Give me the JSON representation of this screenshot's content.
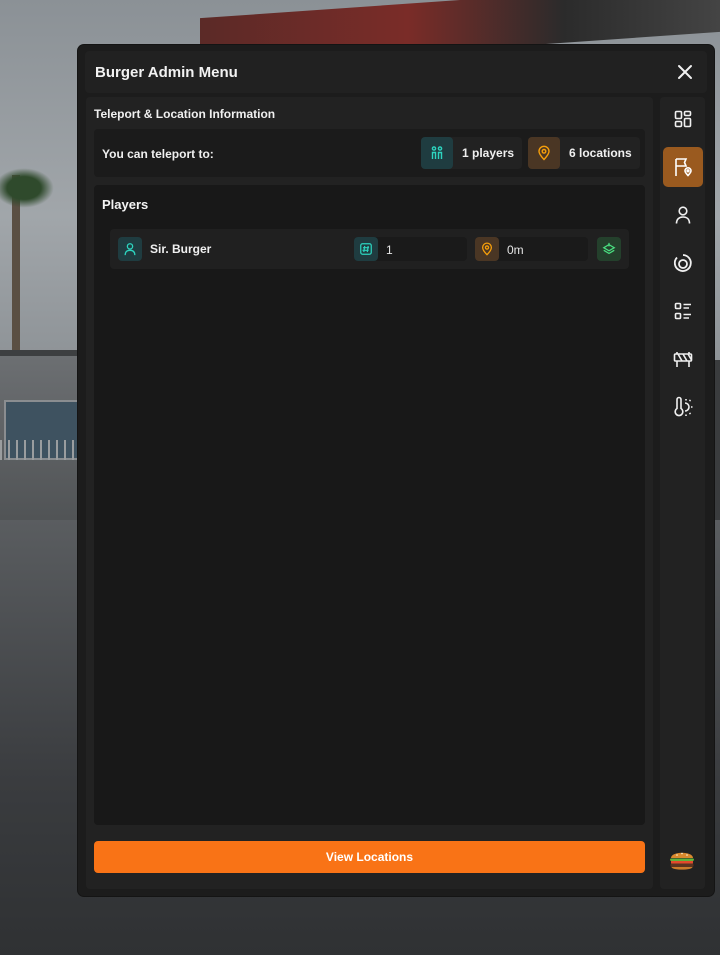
{
  "window": {
    "title": "Burger Admin Menu"
  },
  "teleport": {
    "section_title": "Teleport & Location Information",
    "label": "You can teleport to:",
    "players_count": "1 players",
    "locations_count": "6 locations"
  },
  "players": {
    "title": "Players",
    "rows": [
      {
        "name": "Sir. Burger",
        "id": "1",
        "distance": "0m"
      }
    ]
  },
  "actions": {
    "view_locations": "View Locations"
  },
  "sidebar": {
    "items": [
      {
        "icon": "dashboard-icon",
        "active": false
      },
      {
        "icon": "flag-location-icon",
        "active": true
      },
      {
        "icon": "user-icon",
        "active": false
      },
      {
        "icon": "refresh-circle-icon",
        "active": false
      },
      {
        "icon": "list-icon",
        "active": false
      },
      {
        "icon": "barrier-icon",
        "active": false
      },
      {
        "icon": "weather-icon",
        "active": false
      }
    ]
  },
  "colors": {
    "accent": "#f97316",
    "active_tab": "#9a5a1f",
    "teal": "#2dd4bf",
    "teal_bg": "#1f3c40",
    "orange_bg": "#4a3624"
  }
}
